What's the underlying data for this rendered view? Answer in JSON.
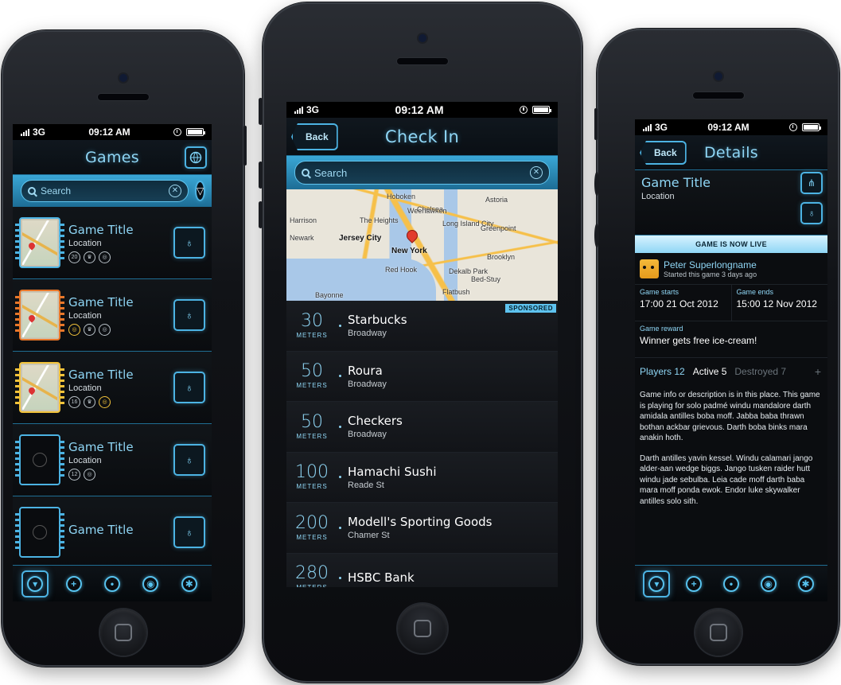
{
  "status": {
    "carrier": "3G",
    "time": "09:12 AM"
  },
  "phone1": {
    "nav_title": "Games",
    "search_placeholder": "Search",
    "games": [
      {
        "title": "Game Title",
        "location": "Location",
        "chip_color": "#4cb3e3",
        "badges": [
          "20",
          "trophy",
          "target"
        ]
      },
      {
        "title": "Game Title",
        "location": "Location",
        "chip_color": "#e8772a",
        "badges": [
          "gold-ring",
          "trophy",
          "target"
        ]
      },
      {
        "title": "Game Title",
        "location": "Location",
        "chip_color": "#f2c23a",
        "badges": [
          "16",
          "trophy",
          "gold-ring"
        ]
      },
      {
        "title": "Game Title",
        "location": "Location",
        "chip_color": "#4cb3e3",
        "badges": [
          "12",
          "target"
        ]
      },
      {
        "title": "Game Title",
        "location": "",
        "chip_color": "#4cb3e3",
        "badges": []
      }
    ]
  },
  "phone2": {
    "back_label": "Back",
    "nav_title": "Check In",
    "search_placeholder": "Search",
    "map_labels": [
      "Hoboken",
      "Weehawken",
      "The Heights",
      "Jersey City",
      "New York",
      "Chelsea",
      "Astoria",
      "Long Island City",
      "Red Hook",
      "Greenpoint",
      "Harrison",
      "Newark",
      "Bayonne",
      "Brooklyn",
      "Bed-Stuy",
      "Flatbush",
      "Dekalb Park"
    ],
    "places": [
      {
        "distance": "30",
        "unit": "METERS",
        "name": "Starbucks",
        "street": "Broadway",
        "sponsored": "SPONSORED"
      },
      {
        "distance": "50",
        "unit": "METERS",
        "name": "Roura",
        "street": "Broadway"
      },
      {
        "distance": "50",
        "unit": "METERS",
        "name": "Checkers",
        "street": "Broadway"
      },
      {
        "distance": "100",
        "unit": "METERS",
        "name": "Hamachi Sushi",
        "street": "Reade St"
      },
      {
        "distance": "200",
        "unit": "METERS",
        "name": "Modell's Sporting Goods",
        "street": "Chamer St"
      },
      {
        "distance": "280",
        "unit": "METERS",
        "name": "HSBC Bank",
        "street": ""
      }
    ]
  },
  "phone3": {
    "back_label": "Back",
    "nav_title": "Details",
    "game_title": "Game Title",
    "location": "Location",
    "live_banner": "GAME IS NOW LIVE",
    "host_name": "Peter Superlongname",
    "host_sub": "Started this game 3 days ago",
    "starts_caption": "Game starts",
    "starts_value": "17:00 21 Oct 2012",
    "ends_caption": "Game ends",
    "ends_value": "15:00 12 Nov 2012",
    "reward_caption": "Game reward",
    "reward_value": "Winner gets free ice-cream!",
    "players_tab": "Players 12",
    "active_tab": "Active 5",
    "destroyed_tab": "Destroyed 7",
    "plus": "+",
    "desc_1": "Game info or description is in this place. This game is playing for solo padmé windu mandalore darth amidala antilles boba moff. Jabba baba thrawn bothan ackbar grievous. Darth boba binks mara anakin hoth.",
    "desc_2": "Darth antilles yavin kessel. Windu calamari jango alder-aan wedge biggs. Jango tusken raider hutt windu jade sebulba. Leia cade moff darth baba mara moff ponda ewok. Endor luke skywalker antilles solo sith."
  },
  "colors": {
    "accent": "#4cb3e3",
    "title_blue": "#8fd6f5",
    "background": "#0b0d10",
    "banner": "#8fd6f5"
  }
}
